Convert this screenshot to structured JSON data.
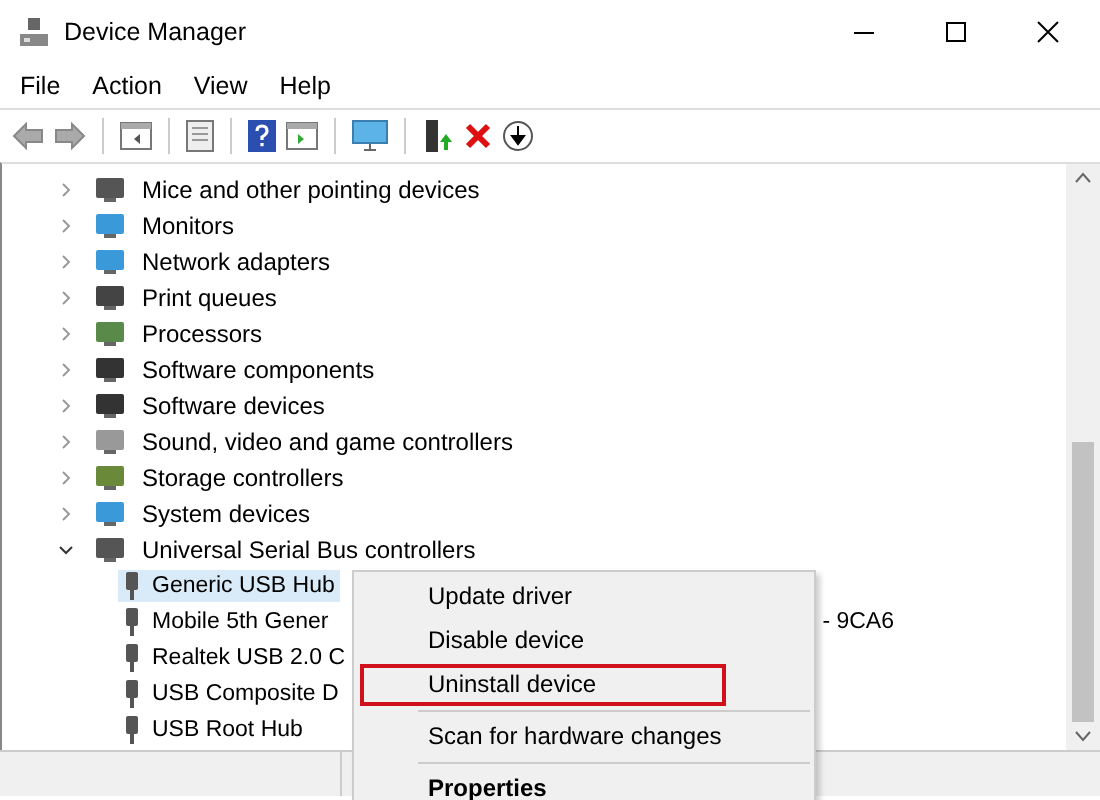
{
  "window": {
    "title": "Device Manager"
  },
  "menu_bar": [
    "File",
    "Action",
    "View",
    "Help"
  ],
  "tree": [
    {
      "label": "Mice and other pointing devices",
      "expanded": false
    },
    {
      "label": "Monitors",
      "expanded": false
    },
    {
      "label": "Network adapters",
      "expanded": false
    },
    {
      "label": "Print queues",
      "expanded": false
    },
    {
      "label": "Processors",
      "expanded": false
    },
    {
      "label": "Software components",
      "expanded": false
    },
    {
      "label": "Software devices",
      "expanded": false
    },
    {
      "label": "Sound, video and game controllers",
      "expanded": false
    },
    {
      "label": "Storage controllers",
      "expanded": false
    },
    {
      "label": "System devices",
      "expanded": false
    },
    {
      "label": "Universal Serial Bus controllers",
      "expanded": true,
      "children": [
        {
          "label": "Generic USB Hub",
          "selected": true
        },
        {
          "label": "Mobile 5th Gener",
          "tail": "- 9CA6",
          "selected": false
        },
        {
          "label": "Realtek USB 2.0 C",
          "selected": false
        },
        {
          "label": "USB Composite D",
          "selected": false
        },
        {
          "label": "USB Root Hub",
          "selected": false
        }
      ]
    }
  ],
  "context_menu": [
    {
      "kind": "item",
      "label": "Update driver",
      "outlined": false,
      "default": false
    },
    {
      "kind": "item",
      "label": "Disable device",
      "outlined": false,
      "default": false
    },
    {
      "kind": "item",
      "label": "Uninstall device",
      "outlined": true,
      "default": false
    },
    {
      "kind": "separator"
    },
    {
      "kind": "item",
      "label": "Scan for hardware changes",
      "outlined": false,
      "default": false
    },
    {
      "kind": "separator"
    },
    {
      "kind": "item",
      "label": "Properties",
      "outlined": false,
      "default": true
    }
  ]
}
